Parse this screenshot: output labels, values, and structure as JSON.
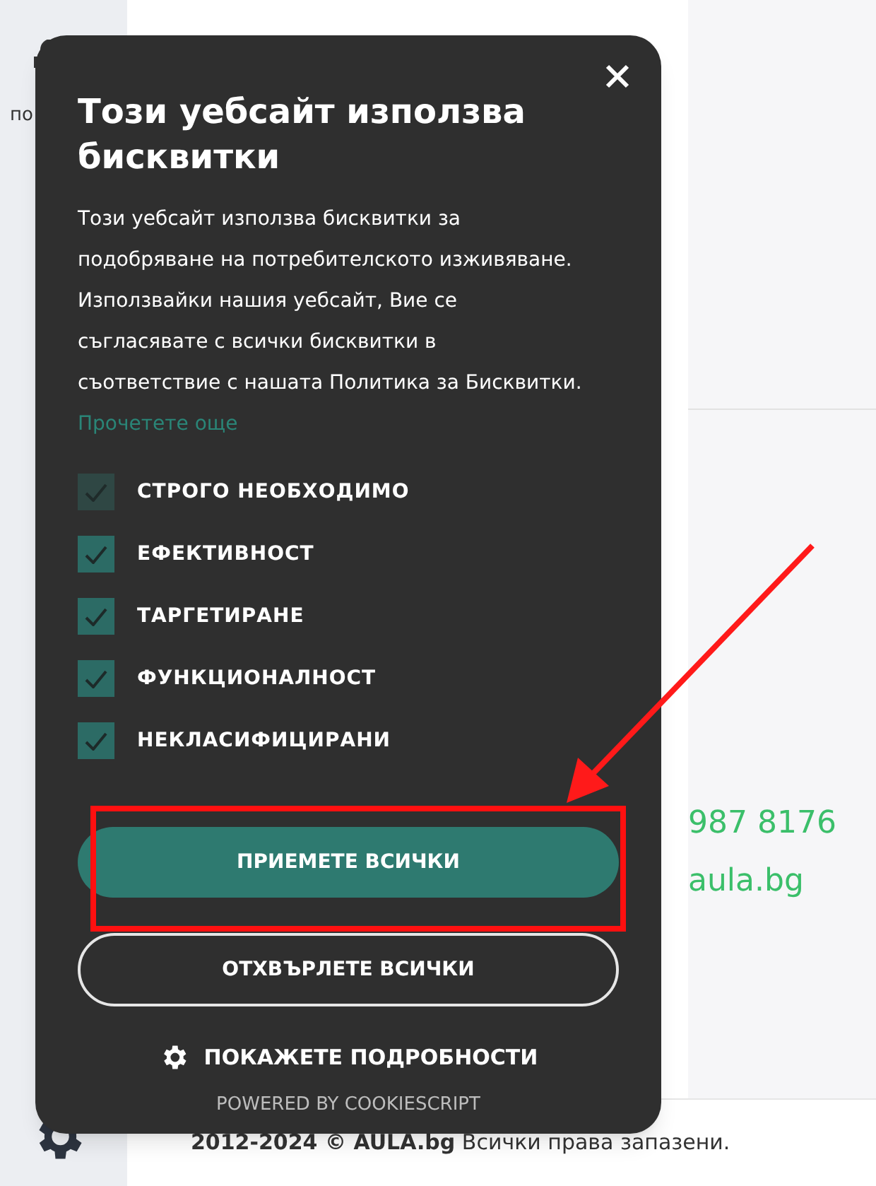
{
  "background": {
    "gift_label": "по",
    "phone": "987 8176",
    "email": "aula.bg",
    "footer": {
      "years": "2012-2024 ©",
      "brand": "AULA.bg",
      "rights": "Всички права запазени."
    }
  },
  "dialog": {
    "title": "Този уебсайт използва бисквитки",
    "body": "Този уебсайт използва бисквитки за подобряване на потребителското изживяване. Използвайки нашия уебсайт, Вие се съгласявате с всички бисквитки в съответствие с нашата Политика за Бисквитки.",
    "link": "Прочетете още",
    "categories": [
      {
        "label": "СТРОГО НЕОБХОДИМО",
        "checked": true,
        "disabled": true
      },
      {
        "label": "ЕФЕКТИВНОСТ",
        "checked": true,
        "disabled": false
      },
      {
        "label": "ТАРГЕТИРАНЕ",
        "checked": true,
        "disabled": false
      },
      {
        "label": "ФУНКЦИОНАЛНОСТ",
        "checked": true,
        "disabled": false
      },
      {
        "label": "НЕКЛАСИФИЦИРАНИ",
        "checked": true,
        "disabled": false
      }
    ],
    "accept": "ПРИЕМЕТЕ ВСИЧКИ",
    "reject": "ОТХВЪРЛЕТЕ ВСИЧКИ",
    "details": "ПОКАЖЕТЕ ПОДРОБНОСТИ",
    "powered": "POWERED BY COOKIESCRIPT"
  }
}
